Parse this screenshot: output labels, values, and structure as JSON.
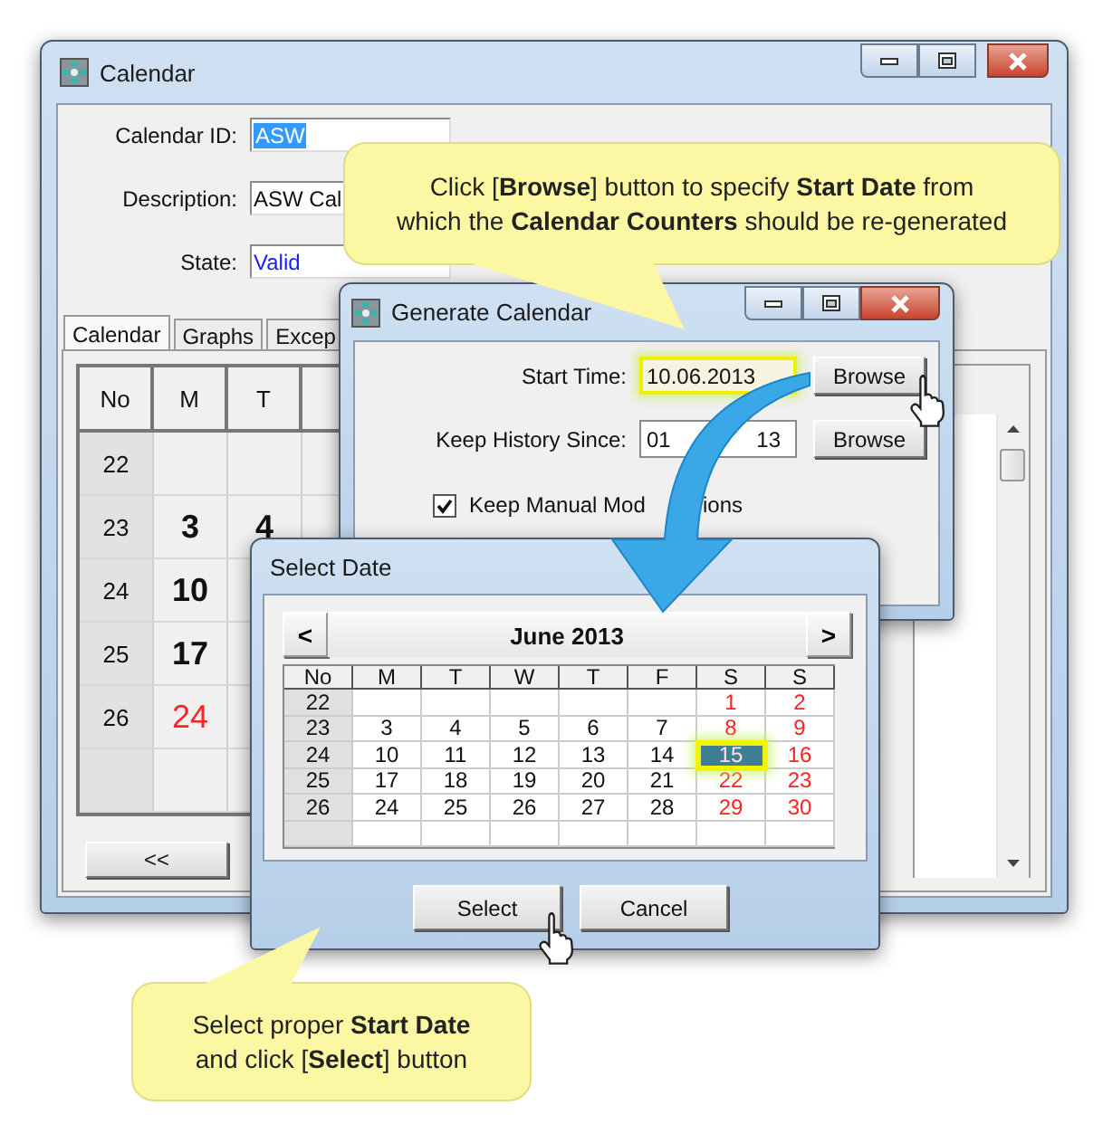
{
  "main_window": {
    "title": "Calendar",
    "fields": [
      {
        "label": "Calendar ID:",
        "value": "ASW",
        "kind": "selected"
      },
      {
        "label": "Description:",
        "value": "ASW Cal",
        "kind": "text"
      },
      {
        "label": "State:",
        "value": "Valid",
        "kind": "link"
      }
    ],
    "tabs": [
      {
        "label": "Calendar",
        "selected": true
      },
      {
        "label": "Graphs",
        "selected": false
      },
      {
        "label": "Excep",
        "selected": false
      }
    ],
    "grid": {
      "columns": [
        "No",
        "M",
        "T"
      ],
      "rows": [
        {
          "no": "22"
        },
        {
          "no": "23",
          "days": [
            {
              "text": "3",
              "holiday": false
            },
            {
              "text": "4",
              "holiday": false
            }
          ]
        },
        {
          "no": "24",
          "days": [
            {
              "text": "10",
              "holiday": false
            }
          ]
        },
        {
          "no": "25",
          "days": [
            {
              "text": "17",
              "holiday": false
            }
          ]
        },
        {
          "no": "26",
          "days": [
            {
              "text": "24",
              "holiday": true
            }
          ]
        }
      ]
    },
    "prev_button": "<<"
  },
  "generate_dialog": {
    "title": "Generate Calendar",
    "start_time": {
      "label": "Start Time:",
      "value": "10.06.2013",
      "highlighted": true,
      "button": "Browse"
    },
    "keep_history": {
      "label": "Keep History Since:",
      "value_parts": [
        "01",
        "13"
      ],
      "button": "Browse"
    },
    "keep_manual": {
      "label_parts": [
        "Keep Manual Mod",
        "ions"
      ],
      "checked": true
    }
  },
  "select_date_dialog": {
    "title": "Select Date",
    "prev": "<",
    "month": "June 2013",
    "next": ">",
    "columns": [
      "No",
      "M",
      "T",
      "W",
      "T",
      "F",
      "S",
      "S"
    ],
    "rows": [
      {
        "no": "22",
        "days": [
          {
            "selected": false
          },
          {
            "selected": false
          },
          {
            "selected": false
          },
          {
            "selected": false
          },
          {
            "selected": false
          },
          {
            "text": "1",
            "holiday": true,
            "selected": false
          },
          {
            "text": "2",
            "holiday": true,
            "selected": false
          }
        ]
      },
      {
        "no": "23",
        "days": [
          {
            "text": "3",
            "holiday": false,
            "selected": false
          },
          {
            "text": "4",
            "holiday": false,
            "selected": false
          },
          {
            "text": "5",
            "holiday": false,
            "selected": false
          },
          {
            "text": "6",
            "holiday": false,
            "selected": false
          },
          {
            "text": "7",
            "holiday": false,
            "selected": false
          },
          {
            "text": "8",
            "holiday": true,
            "selected": false
          },
          {
            "text": "9",
            "holiday": true,
            "selected": false
          }
        ]
      },
      {
        "no": "24",
        "days": [
          {
            "text": "10",
            "holiday": false,
            "selected": false
          },
          {
            "text": "11",
            "holiday": false,
            "selected": false
          },
          {
            "text": "12",
            "holiday": false,
            "selected": false
          },
          {
            "text": "13",
            "holiday": false,
            "selected": false
          },
          {
            "text": "14",
            "holiday": false,
            "selected": false
          },
          {
            "text": "15",
            "holiday": true,
            "selected": true
          },
          {
            "text": "16",
            "holiday": true,
            "selected": false
          }
        ]
      },
      {
        "no": "25",
        "days": [
          {
            "text": "17",
            "holiday": false,
            "selected": false
          },
          {
            "text": "18",
            "holiday": false,
            "selected": false
          },
          {
            "text": "19",
            "holiday": false,
            "selected": false
          },
          {
            "text": "20",
            "holiday": false,
            "selected": false
          },
          {
            "text": "21",
            "holiday": false,
            "selected": false
          },
          {
            "text": "22",
            "holiday": true,
            "selected": false
          },
          {
            "text": "23",
            "holiday": true,
            "selected": false
          }
        ]
      },
      {
        "no": "26",
        "days": [
          {
            "text": "24",
            "holiday": false,
            "selected": false
          },
          {
            "text": "25",
            "holiday": false,
            "selected": false
          },
          {
            "text": "26",
            "holiday": false,
            "selected": false
          },
          {
            "text": "27",
            "holiday": false,
            "selected": false
          },
          {
            "text": "28",
            "holiday": false,
            "selected": false
          },
          {
            "text": "29",
            "holiday": true,
            "selected": false
          },
          {
            "text": "30",
            "holiday": true,
            "selected": false
          }
        ]
      }
    ],
    "buttons": [
      "Select",
      "Cancel"
    ]
  },
  "callouts": [
    {
      "text": "Click [**Browse**] button to specify **Start Date** from\nwhich the **Calendar Counters** should be re-generated"
    },
    {
      "text": "Select proper **Start Date**\nand click [**Select**] button"
    }
  ]
}
